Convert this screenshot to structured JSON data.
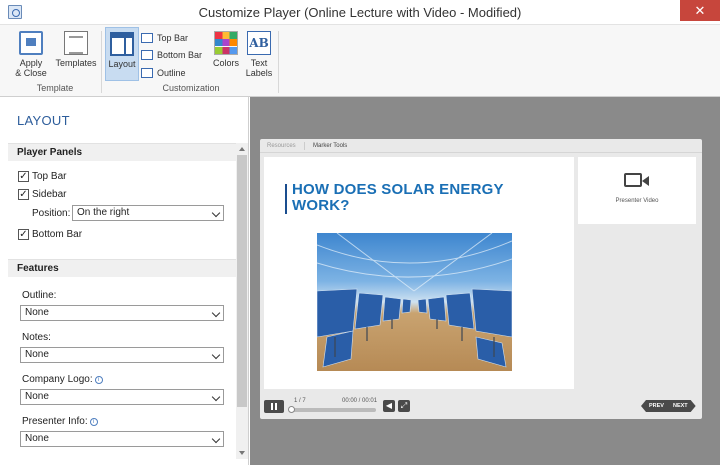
{
  "window": {
    "title": "Customize Player (Online Lecture with Video - Modified)",
    "close_glyph": "✕"
  },
  "ribbon": {
    "apply_close_line1": "Apply",
    "apply_close_line2": "& Close",
    "templates": "Templates",
    "layout": "Layout",
    "top_bar": "Top Bar",
    "bottom_bar": "Bottom Bar",
    "outline": "Outline",
    "colors": "Colors",
    "text_labels_line1": "Text",
    "text_labels_line2": "Labels",
    "text_labels_icon": "AB",
    "group_template": "Template",
    "group_customization": "Customization"
  },
  "left": {
    "heading": "LAYOUT",
    "player_panels": {
      "heading": "Player Panels",
      "top_bar": {
        "label": "Top Bar",
        "checked": true
      },
      "sidebar": {
        "label": "Sidebar",
        "checked": true
      },
      "position_label": "Position:",
      "position_value": "On the right",
      "bottom_bar": {
        "label": "Bottom Bar",
        "checked": true
      }
    },
    "features": {
      "heading": "Features",
      "outline_label": "Outline:",
      "outline_value": "None",
      "notes_label": "Notes:",
      "notes_value": "None",
      "company_logo_label": "Company Logo:",
      "company_logo_value": "None",
      "presenter_info_label": "Presenter Info:",
      "presenter_info_value": "None"
    },
    "check_glyph": "✓",
    "info_glyph": "i"
  },
  "preview": {
    "tabs": [
      "Resources",
      "Marker Tools"
    ],
    "slide_title": "HOW DOES SOLAR ENERGY WORK?",
    "presenter_video": "Presenter Video",
    "slide_count": "1 / 7",
    "time": "00:00 / 00:01",
    "prev": "PREV",
    "next": "NEXT",
    "volume_glyph": "◀",
    "fullscreen_glyph": "⤢"
  }
}
